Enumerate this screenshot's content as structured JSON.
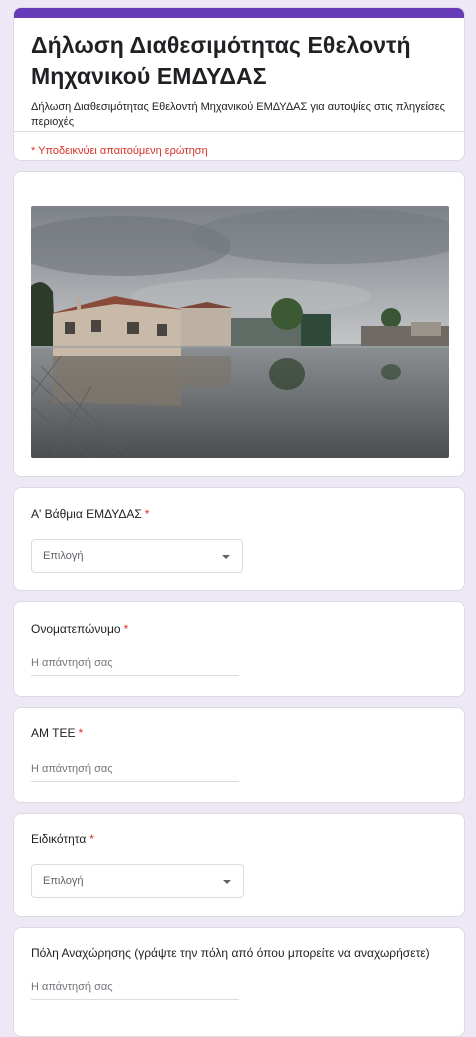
{
  "form": {
    "title": "Δήλωση Διαθεσιμότητας Εθελοντή Μηχανικού ΕΜΔΥΔΑΣ",
    "description": "Δήλωση Διαθεσιμότητας Εθελοντή Μηχανικού ΕΜΔΥΔΑΣ για αυτοψίες στις πληγείσες περιοχές",
    "required_note": "* Υποδεικνύει απαιτούμενη ερώτηση",
    "accent_color": "#673ab7",
    "required_color": "#d93025"
  },
  "questions": [
    {
      "label": "Α' Βάθμια ΕΜΔΥΔΑΣ",
      "required_mark": "*",
      "type": "dropdown",
      "value": "Επιλογή"
    },
    {
      "label": "Ονοματεπώνυμο",
      "required_mark": "*",
      "type": "text",
      "placeholder": "Η απάντησή σας"
    },
    {
      "label": "ΑΜ ΤΕΕ",
      "required_mark": "*",
      "type": "text",
      "placeholder": "Η απάντησή σας"
    },
    {
      "label": "Ειδικότητα",
      "required_mark": "*",
      "type": "dropdown",
      "value": "Επιλογή"
    },
    {
      "label": "Πόλη Αναχώρησης (γράψτε την πόλη από όπου μπορείτε να αναχωρήσετε)",
      "type": "text",
      "placeholder": "Η απάντησή σας"
    }
  ]
}
